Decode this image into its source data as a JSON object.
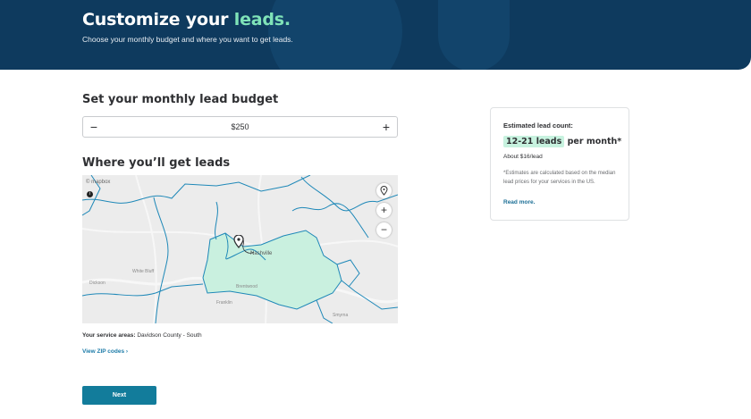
{
  "hero": {
    "title_main": "Customize your ",
    "title_accent": "leads.",
    "subtitle": "Choose your monthly budget and where you want to get leads."
  },
  "budget": {
    "heading": "Set your monthly lead budget",
    "decrement_label": "−",
    "increment_label": "+",
    "value": "$250"
  },
  "map_section": {
    "heading": "Where you’ll get leads",
    "logo_text": "© mapbox",
    "info_label": "i",
    "zoom_in_label": "+",
    "zoom_out_label": "−",
    "places": [
      "Nashville",
      "White Bluff",
      "Dickson",
      "Brentwood",
      "Franklin",
      "Smyrna"
    ],
    "service_area_label": "Your service areas:",
    "service_area_value": "Davidson County - South",
    "zip_link": "View ZIP codes  ›"
  },
  "estimate": {
    "title": "Estimated lead count:",
    "leads_range": "12-21 leads",
    "per_month": "per month*",
    "per_lead": "About $16/lead",
    "note": "*Estimates are calculated based on the median lead prices for your services in the US.",
    "read_more": "Read more."
  },
  "actions": {
    "next_label": "Next"
  },
  "colors": {
    "hero_bg": "#0e3a5e",
    "accent_green": "#7fe3b8",
    "primary_button": "#127c9b",
    "map_boundary": "#1e88b8",
    "service_area_fill": "#c9f0df"
  }
}
